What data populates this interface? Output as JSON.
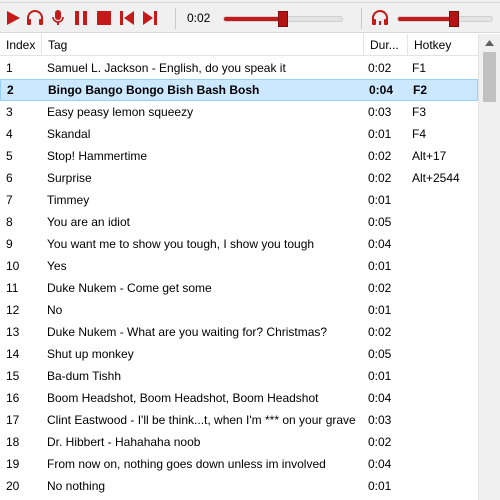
{
  "toolbar": {
    "buttons": [
      {
        "name": "play-icon"
      },
      {
        "name": "headphones-icon"
      },
      {
        "name": "microphone-icon"
      },
      {
        "name": "pause-icon"
      },
      {
        "name": "stop-icon"
      },
      {
        "name": "skip-previous-icon"
      },
      {
        "name": "skip-next-icon"
      }
    ],
    "time": "0:02",
    "seek_progress": 0.5,
    "volume_progress": 0.6,
    "accent": "#c41a1a"
  },
  "table": {
    "columns": [
      "Index",
      "Tag",
      "Dur...",
      "Hotkey"
    ],
    "selected_index": 1,
    "rows": [
      {
        "index": "1",
        "tag": "Samuel L. Jackson - English, do you speak it",
        "dur": "0:02",
        "hotkey": "F1"
      },
      {
        "index": "2",
        "tag": "Bingo Bango Bongo Bish Bash Bosh",
        "dur": "0:04",
        "hotkey": "F2"
      },
      {
        "index": "3",
        "tag": "Easy peasy lemon squeezy",
        "dur": "0:03",
        "hotkey": "F3"
      },
      {
        "index": "4",
        "tag": "Skandal",
        "dur": "0:01",
        "hotkey": "F4"
      },
      {
        "index": "5",
        "tag": "Stop! Hammertime",
        "dur": "0:02",
        "hotkey": "Alt+17"
      },
      {
        "index": "6",
        "tag": "Surprise",
        "dur": "0:02",
        "hotkey": "Alt+2544"
      },
      {
        "index": "7",
        "tag": "Timmey",
        "dur": "0:01",
        "hotkey": ""
      },
      {
        "index": "8",
        "tag": "You are an idiot",
        "dur": "0:05",
        "hotkey": ""
      },
      {
        "index": "9",
        "tag": "You want me to show you tough, I show you tough",
        "dur": "0:04",
        "hotkey": ""
      },
      {
        "index": "10",
        "tag": "Yes",
        "dur": "0:01",
        "hotkey": ""
      },
      {
        "index": "11",
        "tag": "Duke Nukem - Come get some",
        "dur": "0:02",
        "hotkey": ""
      },
      {
        "index": "12",
        "tag": "No",
        "dur": "0:01",
        "hotkey": ""
      },
      {
        "index": "13",
        "tag": "Duke Nukem - What are you waiting for? Christmas?",
        "dur": "0:02",
        "hotkey": ""
      },
      {
        "index": "14",
        "tag": "Shut up monkey",
        "dur": "0:05",
        "hotkey": ""
      },
      {
        "index": "15",
        "tag": "Ba-dum Tishh",
        "dur": "0:01",
        "hotkey": ""
      },
      {
        "index": "16",
        "tag": "Boom Headshot, Boom Headshot, Boom Headshot",
        "dur": "0:04",
        "hotkey": ""
      },
      {
        "index": "17",
        "tag": "Clint Eastwood - I'll be think...t, when I'm *** on your grave",
        "dur": "0:03",
        "hotkey": ""
      },
      {
        "index": "18",
        "tag": "Dr. Hibbert - Hahahaha noob",
        "dur": "0:02",
        "hotkey": ""
      },
      {
        "index": "19",
        "tag": "From now on, nothing goes down unless im involved",
        "dur": "0:04",
        "hotkey": ""
      },
      {
        "index": "20",
        "tag": "No nothing",
        "dur": "0:01",
        "hotkey": ""
      }
    ]
  }
}
